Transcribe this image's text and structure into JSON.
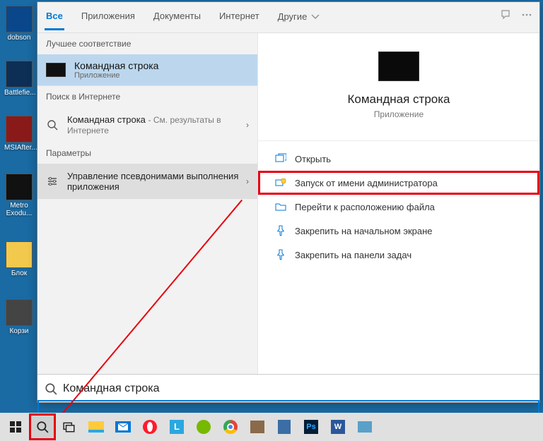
{
  "desktop": {
    "icons": [
      {
        "label": "dobson",
        "c": "#0a478a"
      },
      {
        "label": "Battlefie...",
        "c": "#0d2f55"
      },
      {
        "label": "MSIAfter...",
        "c": "#8a1a1a"
      },
      {
        "label": "Metro Exodu...",
        "c": "#111"
      },
      {
        "label": "Блок",
        "c": "#f2c94c"
      },
      {
        "label": "Корзи",
        "c": "#444"
      }
    ]
  },
  "tabs": {
    "items": [
      {
        "label": "Все",
        "active": true
      },
      {
        "label": "Приложения"
      },
      {
        "label": "Документы"
      },
      {
        "label": "Интернет"
      },
      {
        "label": "Другие"
      }
    ]
  },
  "sections": {
    "best": "Лучшее соответствие",
    "web": "Поиск в Интернете",
    "params": "Параметры"
  },
  "best_match": {
    "title": "Командная строка",
    "subtitle": "Приложение"
  },
  "web_result": {
    "label": "Командная строка",
    "hint": "- См. результаты в Интернете"
  },
  "params_row": "Управление псевдонимами выполнения приложения",
  "preview": {
    "title": "Командная строка",
    "subtitle": "Приложение"
  },
  "actions": [
    "Открыть",
    "Запуск от имени администратора",
    "Перейти к расположению файла",
    "Закрепить на начальном экране",
    "Закрепить на панели задач"
  ],
  "search": {
    "value": "Командная строка"
  },
  "taskbar": {
    "icons": [
      {
        "n": "start",
        "c": "#222"
      },
      {
        "n": "search",
        "c": "#222"
      },
      {
        "n": "taskview",
        "c": "#222"
      },
      {
        "n": "explorer",
        "c": "#ffcb3d"
      },
      {
        "n": "mail",
        "c": "#0078d7"
      },
      {
        "n": "opera",
        "c": "#ff1b2d"
      },
      {
        "n": "lapp",
        "c": "#2aa8e0"
      },
      {
        "n": "nvidia",
        "c": "#76b900"
      },
      {
        "n": "chrome",
        "c": "#f2c94c"
      },
      {
        "n": "app1",
        "c": "#8a6a4a"
      },
      {
        "n": "calc",
        "c": "#3a6ea5"
      },
      {
        "n": "ps",
        "c": "#001e36"
      },
      {
        "n": "word",
        "c": "#2b579a"
      },
      {
        "n": "app2",
        "c": "#5aa0c8"
      }
    ]
  }
}
